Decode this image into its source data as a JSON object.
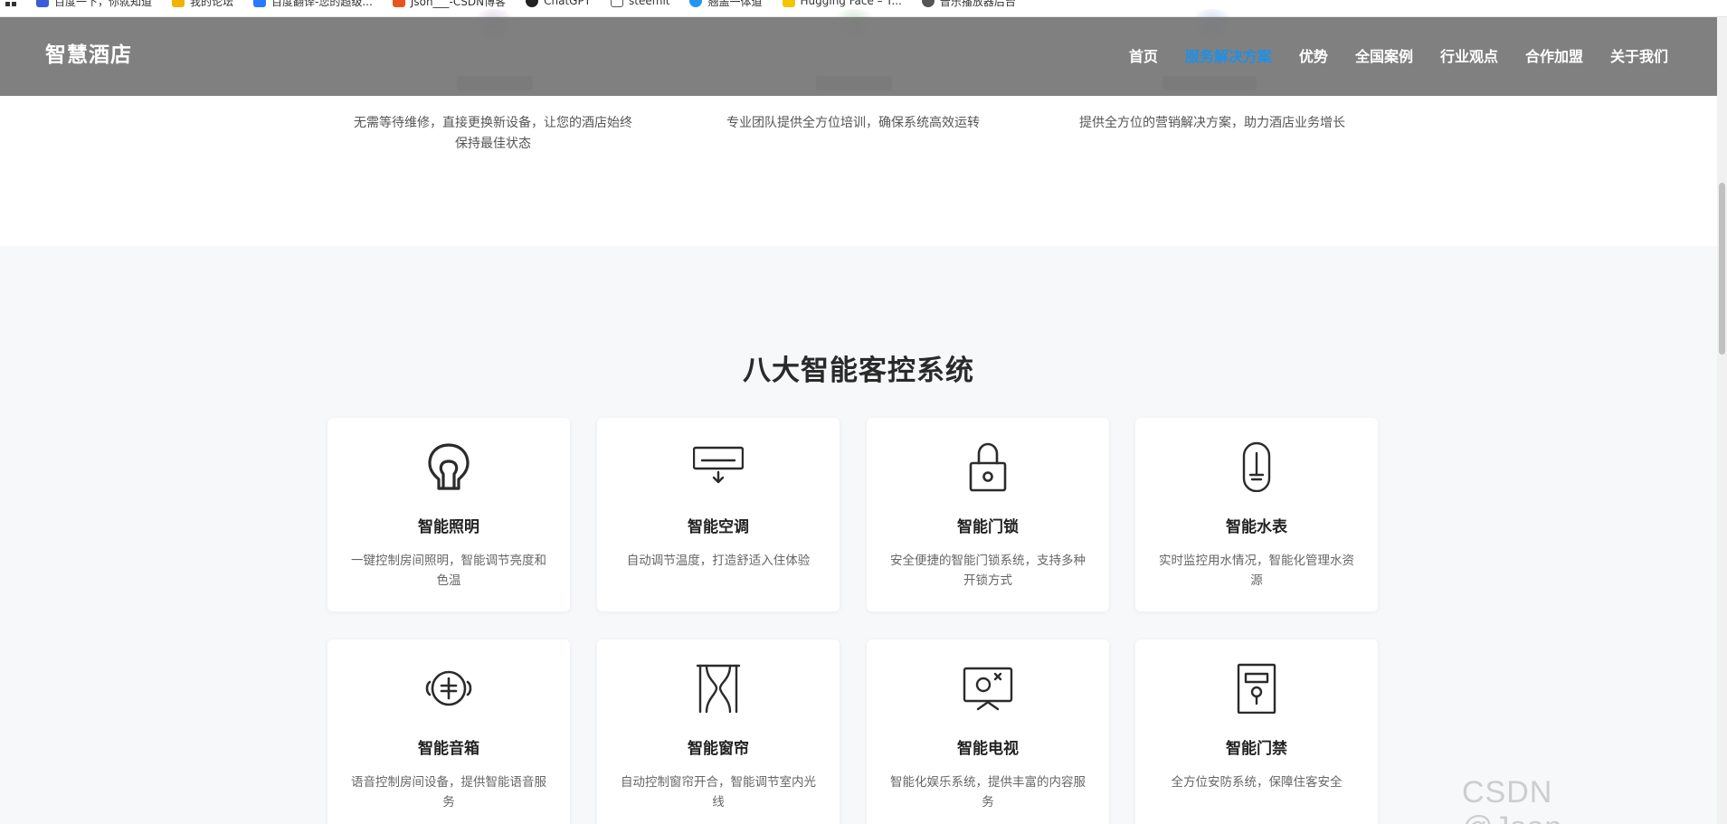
{
  "bookmarks": [
    {
      "label": "百度一下，你就知道",
      "color": "#3b5cd8"
    },
    {
      "label": "我的论坛",
      "color": "#f0b400"
    },
    {
      "label": "百度翻译-您的超级...",
      "color": "#2979ff"
    },
    {
      "label": "Json___-CSDN博客",
      "color": "#e8541e"
    },
    {
      "label": "ChatGPT",
      "color": "#222222"
    },
    {
      "label": "steemit",
      "color": "#555555"
    },
    {
      "label": "翘盖一体道",
      "color": "#2196f3"
    },
    {
      "label": "Hugging Face – T...",
      "color": "#f4c400"
    },
    {
      "label": "音乐播放器后台",
      "color": "#555555"
    }
  ],
  "header": {
    "logo": "智慧酒店",
    "nav": [
      {
        "label": "首页",
        "active": false
      },
      {
        "label": "服务解决方案",
        "active": true
      },
      {
        "label": "优势",
        "active": false
      },
      {
        "label": "全国案例",
        "active": false
      },
      {
        "label": "行业观点",
        "active": false
      },
      {
        "label": "合作加盟",
        "active": false
      },
      {
        "label": "关于我们",
        "active": false
      }
    ]
  },
  "features": [
    {
      "desc_line1": "无需等待维修，直接更换新设备，让您的酒店始终",
      "desc_line2": "保持最佳状态"
    },
    {
      "desc_line1": "专业团队提供全方位培训，确保系统高效运转",
      "desc_line2": ""
    },
    {
      "desc_line1": "提供全方位的营销解决方案，助力酒店业务增长",
      "desc_line2": ""
    }
  ],
  "systems": {
    "title": "八大智能客控系统",
    "cards": [
      {
        "icon": "bulb-icon",
        "title": "智能照明",
        "desc": "一键控制房间照明，智能调节亮度和色温"
      },
      {
        "icon": "air-conditioner-icon",
        "title": "智能空调",
        "desc": "自动调节温度，打造舒适入住体验"
      },
      {
        "icon": "lock-icon",
        "title": "智能门锁",
        "desc": "安全便捷的智能门锁系统，支持多种开锁方式"
      },
      {
        "icon": "water-meter-icon",
        "title": "智能水表",
        "desc": "实时监控用水情况，智能化管理水资源"
      },
      {
        "icon": "speaker-icon",
        "title": "智能音箱",
        "desc": "语音控制房间设备，提供智能语音服务"
      },
      {
        "icon": "curtain-icon",
        "title": "智能窗帘",
        "desc": "自动控制窗帘开合，智能调节室内光线"
      },
      {
        "icon": "tv-icon",
        "title": "智能电视",
        "desc": "智能化娱乐系统，提供丰富的内容服务"
      },
      {
        "icon": "access-control-icon",
        "title": "智能门禁",
        "desc": "全方位安防系统，保障住客安全"
      }
    ]
  },
  "watermark": "CSDN @Json_____"
}
